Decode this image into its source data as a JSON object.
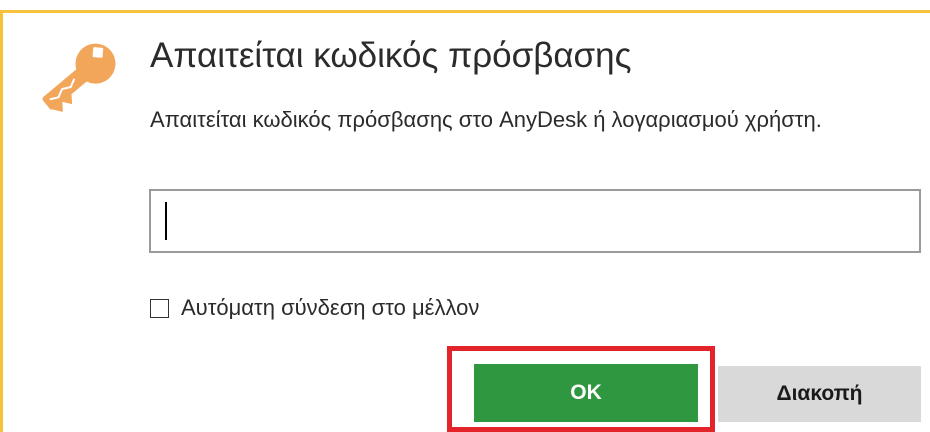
{
  "dialog": {
    "icon": "key-icon",
    "title": "Απαιτείται κωδικός πρόσβασης",
    "description": "Απαιτείται κωδικός πρόσβασης στο AnyDesk ή λογαριασμού χρήστη.",
    "password": {
      "value": "",
      "placeholder": ""
    },
    "auto_login": {
      "label": "Αυτόματη σύνδεση στο μέλλον",
      "checked": false
    },
    "ok_label": "OK",
    "cancel_label": "Διακοπή"
  },
  "colors": {
    "accent": "#f7c23b",
    "key_icon": "#f2a65a",
    "ok_button": "#2f9740",
    "cancel_button": "#d9d9d9",
    "highlight": "#e3242b"
  }
}
